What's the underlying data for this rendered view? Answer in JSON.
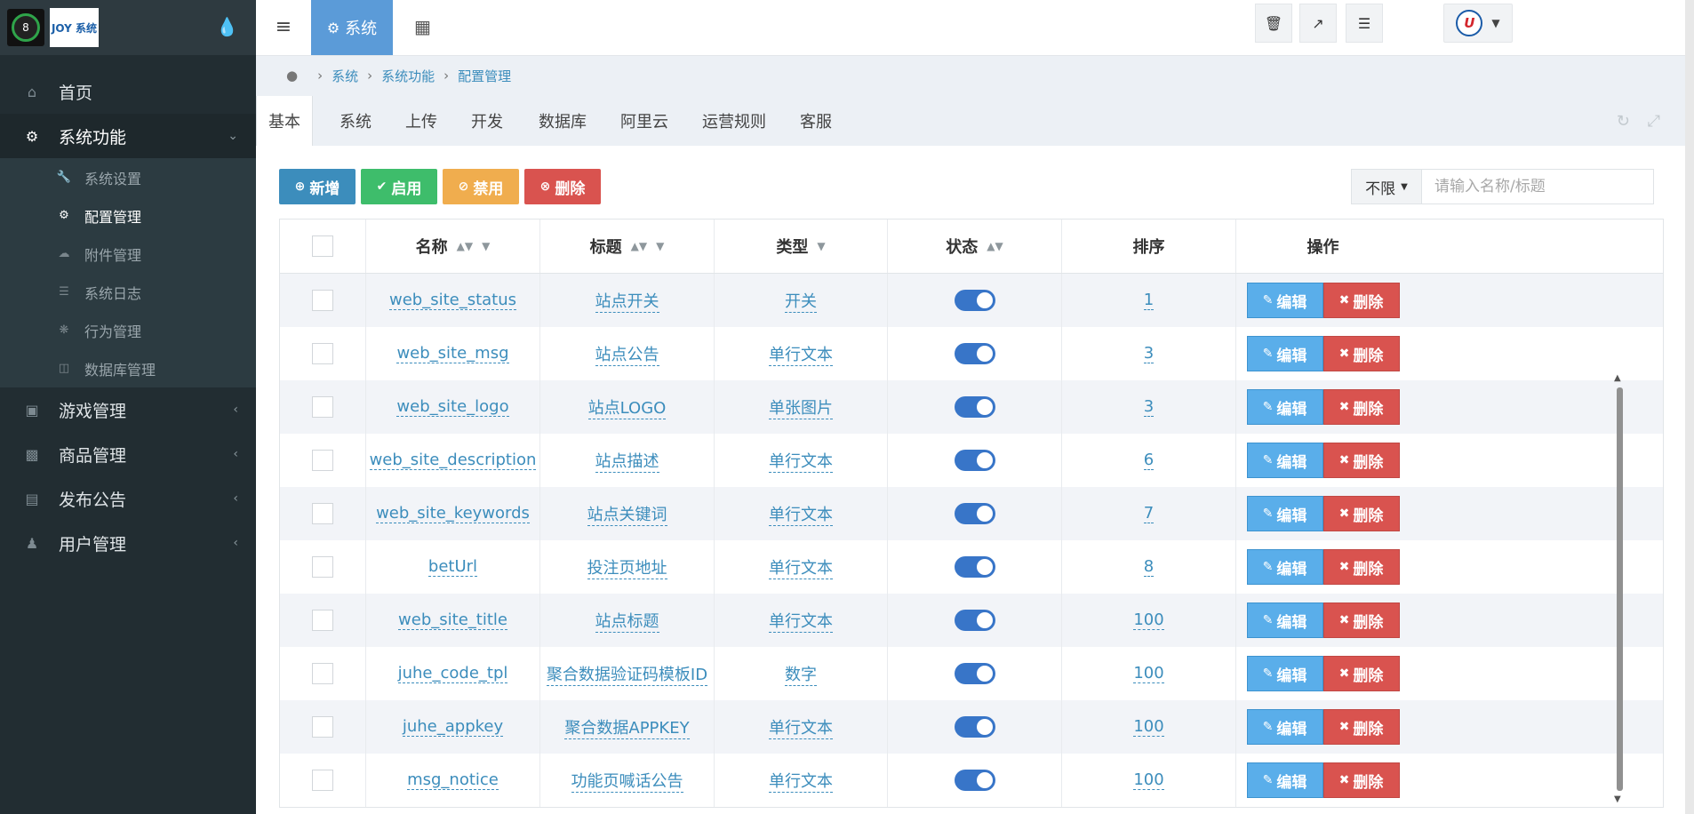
{
  "logo": {
    "text": "JOY 系统"
  },
  "sidebar": {
    "items": [
      {
        "label": "首页",
        "icon": "home-icon"
      },
      {
        "label": "系统功能",
        "icon": "gear-icon",
        "active": true,
        "children": [
          {
            "label": "系统设置",
            "icon": "wrench-icon"
          },
          {
            "label": "配置管理",
            "icon": "cogs-icon",
            "current": true
          },
          {
            "label": "附件管理",
            "icon": "cloud-upload-icon"
          },
          {
            "label": "系统日志",
            "icon": "book-icon"
          },
          {
            "label": "行为管理",
            "icon": "bug-icon"
          },
          {
            "label": "数据库管理",
            "icon": "database-icon"
          }
        ]
      },
      {
        "label": "游戏管理",
        "icon": "gamepad-icon"
      },
      {
        "label": "商品管理",
        "icon": "shopping-bag-icon"
      },
      {
        "label": "发布公告",
        "icon": "newspaper-icon"
      },
      {
        "label": "用户管理",
        "icon": "users-icon"
      }
    ]
  },
  "topbar": {
    "system_tab": "系统"
  },
  "breadcrumb": [
    "系统",
    "系统功能",
    "配置管理"
  ],
  "tabs": [
    "基本",
    "系统",
    "上传",
    "开发",
    "数据库",
    "阿里云",
    "运营规则",
    "客服"
  ],
  "toolbar": {
    "add": "新增",
    "enable": "启用",
    "disable": "禁用",
    "delete": "删除",
    "filter": "不限",
    "search_placeholder": "请输入名称/标题"
  },
  "table": {
    "headers": [
      "名称",
      "标题",
      "类型",
      "状态",
      "排序",
      "操作"
    ],
    "edit_label": "编辑",
    "delete_label": "删除",
    "rows": [
      {
        "name": "web_site_status",
        "title": "站点开关",
        "type": "开关",
        "sort": "1"
      },
      {
        "name": "web_site_msg",
        "title": "站点公告",
        "type": "单行文本",
        "sort": "3"
      },
      {
        "name": "web_site_logo",
        "title": "站点LOGO",
        "type": "单张图片",
        "sort": "3"
      },
      {
        "name": "web_site_description",
        "title": "站点描述",
        "type": "单行文本",
        "sort": "6"
      },
      {
        "name": "web_site_keywords",
        "title": "站点关键词",
        "type": "单行文本",
        "sort": "7"
      },
      {
        "name": "betUrl",
        "title": "投注页地址",
        "type": "单行文本",
        "sort": "8"
      },
      {
        "name": "web_site_title",
        "title": "站点标题",
        "type": "单行文本",
        "sort": "100"
      },
      {
        "name": "juhe_code_tpl",
        "title": "聚合数据验证码模板ID",
        "type": "数字",
        "sort": "100"
      },
      {
        "name": "juhe_appkey",
        "title": "聚合数据APPKEY",
        "type": "单行文本",
        "sort": "100"
      },
      {
        "name": "msg_notice",
        "title": "功能页喊话公告",
        "type": "单行文本",
        "sort": "100"
      }
    ]
  }
}
